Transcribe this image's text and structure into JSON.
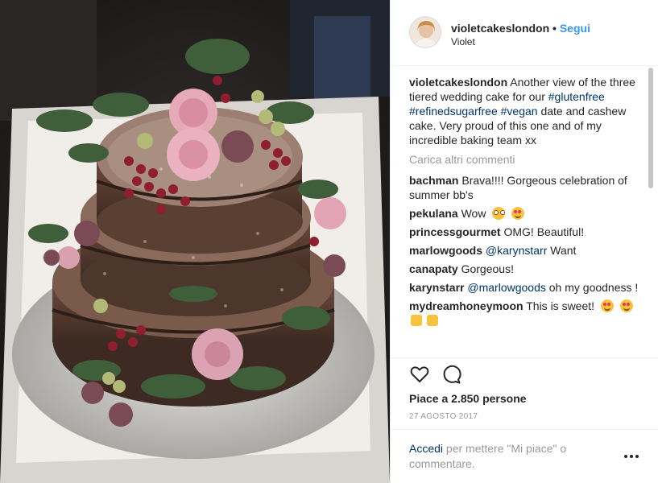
{
  "header": {
    "username": "violetcakeslondon",
    "separator": "•",
    "follow_label": "Segui",
    "subtitle": "Violet"
  },
  "caption": {
    "username": "violetcakeslondon",
    "text_1": "Another view of the three tiered wedding cake for our",
    "hashtags": [
      "#glutenfree",
      "#refinedsugarfree",
      "#vegan"
    ],
    "text_2": "date and cashew cake. Very proud of this one and of my incredible baking team xx"
  },
  "load_more_label": "Carica altri commenti",
  "comments": [
    {
      "user": "bachman",
      "text": "Brava!!!! Gorgeous celebration of summer bb's"
    },
    {
      "user": "pekulana",
      "text": "Wow",
      "emojis": [
        "flushed-face-emoji",
        "heart-eyes-emoji"
      ]
    },
    {
      "user": "princessgourmet",
      "text": "OMG! Beautiful!"
    },
    {
      "user": "marlowgoods",
      "mention": "@karynstarr",
      "text": "Want"
    },
    {
      "user": "canapaty",
      "text": "Gorgeous!"
    },
    {
      "user": "karynstarr",
      "mention": "@marlowgoods",
      "text": "oh my goodness !"
    },
    {
      "user": "mydreamhoneymoon",
      "text": "This is sweet!",
      "emojis": [
        "heart-eyes-emoji",
        "heart-eyes-emoji",
        "thumbs-up-emoji",
        "thumbs-up-emoji"
      ]
    }
  ],
  "icons": {
    "like": "heart-outline-icon",
    "comment": "comment-bubble-icon",
    "more": "more-options-icon"
  },
  "likes_label": "Piace a 2.850 persone",
  "date_label": "27 AGOSTO 2017",
  "login": {
    "link_label": "Accedi",
    "text": "per mettere \"Mi piace\" o commentare."
  },
  "colors": {
    "link": "#3897f0",
    "hashtag": "#003569",
    "muted": "#999999",
    "text": "#262626"
  },
  "photo": {
    "subject": "three-tiered naked wedding cake with roses, figs and berries"
  }
}
